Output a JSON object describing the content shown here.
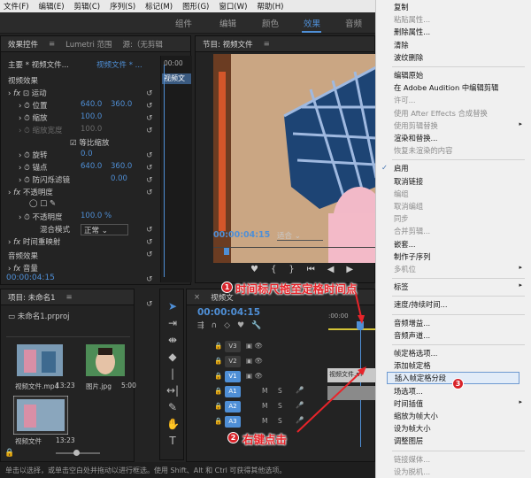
{
  "menubar": [
    "文件(F)",
    "编辑(E)",
    "剪辑(C)",
    "序列(S)",
    "标记(M)",
    "图形(G)",
    "窗口(W)",
    "帮助(H)"
  ],
  "workspace": {
    "tabs": [
      "组件",
      "编辑",
      "颜色",
      "效果",
      "音频"
    ],
    "active": "效果"
  },
  "effect_controls": {
    "tabs": [
      "效果控件",
      "Lumetri 范围",
      "源:（无剪辑"
    ],
    "master": "主要 * 视频文件...",
    "sequence": "视频文件 * ...",
    "clip_label": "视频文",
    "time_start": "00:00",
    "rows": {
      "video_fx": "视频效果",
      "motion": "运动",
      "position": "位置",
      "pos_x": "640.0",
      "pos_y": "360.0",
      "scale": "缩放",
      "scale_v": "100.0",
      "scale_w": "缩放宽度",
      "scale_w_v": "100.0",
      "uniform": "等比缩放",
      "rotation": "旋转",
      "rotation_v": "0.0",
      "anchor": "锚点",
      "anchor_x": "640.0",
      "anchor_y": "360.0",
      "antiflicker": "防闪烁滤镜",
      "antiflicker_v": "0.00",
      "opacity": "不透明度",
      "opacity_sub": "不透明度",
      "opacity_v": "100.0 %",
      "blend": "混合模式",
      "blend_v": "正常",
      "timeremap": "时间重映射",
      "audio_fx": "音频效果",
      "volume": "音量"
    },
    "timecode": "00:00:04:15"
  },
  "program": {
    "title": "节目: 视频文件",
    "timecode": "00:00:04:15",
    "fit": "适合",
    "fit_options": [
      "适合"
    ]
  },
  "project": {
    "title": "项目: 未命名1",
    "file": "未命名1.prproj",
    "bins": [
      {
        "name": "视频文件.mp4",
        "dur": "13:23"
      },
      {
        "name": "图片.jpg",
        "dur": "5:00"
      },
      {
        "name": "视频文件",
        "dur": "13:23"
      }
    ]
  },
  "timeline": {
    "tab": "视频文",
    "timecode": "00:00:04:15",
    "ruler": ":00:00",
    "tracks": [
      {
        "id": "V3",
        "kind": "v"
      },
      {
        "id": "V2",
        "kind": "v"
      },
      {
        "id": "V1",
        "kind": "v"
      },
      {
        "id": "A1",
        "kind": "a"
      },
      {
        "id": "A2",
        "kind": "a"
      },
      {
        "id": "A3",
        "kind": "a"
      }
    ],
    "clip_label": "视频文件.m",
    "mute": "M",
    "solo": "S"
  },
  "statusbar": "单击以选择，或单击空白处并拖动以进行框选。使用 Shift、Alt 和 Ctrl 可获得其他选项。",
  "context_menu": {
    "items": [
      {
        "label": "复制",
        "state": "enabled"
      },
      {
        "label": "粘贴属性...",
        "state": "disabled"
      },
      {
        "label": "删除属性...",
        "state": "enabled"
      },
      {
        "label": "清除",
        "state": "enabled"
      },
      {
        "label": "波纹删除",
        "state": "enabled"
      },
      {
        "label": "编辑原始",
        "state": "enabled"
      },
      {
        "label": "在 Adobe Audition 中编辑剪辑",
        "state": "enabled"
      },
      {
        "label": "许可...",
        "state": "disabled"
      },
      {
        "label": "使用 After Effects 合成替换",
        "state": "disabled"
      },
      {
        "label": "使用剪辑替换",
        "state": "disabled"
      },
      {
        "label": "渲染和替换...",
        "state": "enabled"
      },
      {
        "label": "恢复未渲染的内容",
        "state": "disabled"
      },
      {
        "label": "启用",
        "state": "checked"
      },
      {
        "label": "取消链接",
        "state": "enabled"
      },
      {
        "label": "编组",
        "state": "disabled"
      },
      {
        "label": "取消编组",
        "state": "disabled"
      },
      {
        "label": "同步",
        "state": "disabled"
      },
      {
        "label": "合并剪辑...",
        "state": "disabled"
      },
      {
        "label": "嵌套...",
        "state": "enabled"
      },
      {
        "label": "制作子序列",
        "state": "enabled"
      },
      {
        "label": "多机位",
        "state": "disabled"
      },
      {
        "label": "标签",
        "state": "enabled"
      },
      {
        "label": "速度/持续时间...",
        "state": "enabled"
      },
      {
        "label": "音频增益...",
        "state": "enabled"
      },
      {
        "label": "音频声道...",
        "state": "enabled"
      },
      {
        "label": "帧定格选项...",
        "state": "enabled"
      },
      {
        "label": "添加帧定格",
        "state": "enabled"
      },
      {
        "label": "插入帧定格分段",
        "state": "highlighted"
      },
      {
        "label": "场选项...",
        "state": "enabled"
      },
      {
        "label": "时间插值",
        "state": "enabled"
      },
      {
        "label": "缩放为帧大小",
        "state": "enabled"
      },
      {
        "label": "设为帧大小",
        "state": "enabled"
      },
      {
        "label": "调整图层",
        "state": "enabled"
      },
      {
        "label": "链接媒体...",
        "state": "disabled"
      },
      {
        "label": "设为脱机...",
        "state": "disabled"
      }
    ]
  },
  "callouts": [
    {
      "n": "1",
      "text": "时间标尺拖至定格时间点"
    },
    {
      "n": "2",
      "text": "右键点击"
    },
    {
      "n": "3",
      "text": ""
    }
  ],
  "colors": {
    "accent": "#4f8fd6",
    "callout": "#e8242a",
    "menu_bg": "#f0f0f0",
    "highlight": "#e2ecf8",
    "track_blue": "#4f8fd6"
  }
}
